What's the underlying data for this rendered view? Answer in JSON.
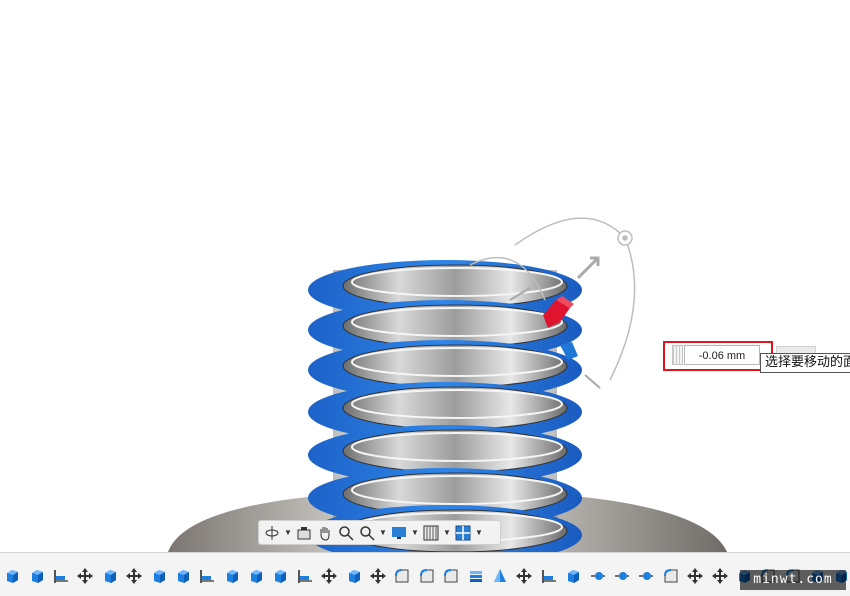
{
  "viewport": {
    "model": "threaded-bolt",
    "selection_color": "#1f6fd6",
    "gizmo_accent": "#e0142f"
  },
  "measure": {
    "value": "-0.06 mm",
    "tooltip": "选择要移动的面"
  },
  "nav_toolbar": {
    "buttons": [
      {
        "name": "orbit-icon",
        "dropdown": true
      },
      {
        "name": "look-at-icon",
        "dropdown": false
      },
      {
        "name": "pan-icon",
        "dropdown": false
      },
      {
        "name": "zoom-icon",
        "dropdown": false
      },
      {
        "name": "zoom-window-icon",
        "dropdown": true
      },
      {
        "name": "display-settings-icon",
        "dropdown": true
      },
      {
        "name": "grid-snaps-icon",
        "dropdown": true
      },
      {
        "name": "viewports-icon",
        "dropdown": true
      }
    ]
  },
  "timeline": {
    "icons": [
      "box",
      "box",
      "joint",
      "move",
      "box",
      "move",
      "box",
      "box",
      "joint",
      "box",
      "box",
      "box",
      "joint",
      "move",
      "box",
      "move",
      "fillet",
      "fillet",
      "fillet",
      "layers",
      "cone",
      "move",
      "joint",
      "box",
      "point",
      "point",
      "point",
      "fillet",
      "move",
      "move",
      "box",
      "fillet",
      "fillet",
      "box",
      "box"
    ]
  },
  "watermark": "minwt.com"
}
